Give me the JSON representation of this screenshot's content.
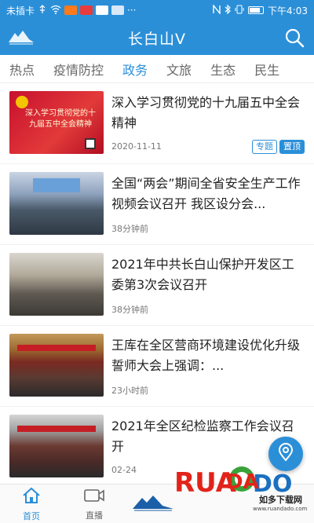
{
  "status_bar": {
    "carrier": "未插卡",
    "time": "下午4:03",
    "battery_percent": 80,
    "left_icons": [
      "usb-icon",
      "wifi-icon",
      "app-icon-1",
      "app-icon-2",
      "app-icon-3",
      "app-icon-4",
      "more-dots-icon"
    ],
    "right_icons": [
      "nfc-icon",
      "bluetooth-icon",
      "vibrate-icon",
      "battery-icon"
    ]
  },
  "header": {
    "title": "长白山V",
    "search_icon": "search-icon",
    "background": "#2b8fd8"
  },
  "tabs": [
    {
      "label": "热点",
      "active": false
    },
    {
      "label": "疫情防控",
      "active": false
    },
    {
      "label": "政务",
      "active": true
    },
    {
      "label": "文旅",
      "active": false
    },
    {
      "label": "生态",
      "active": false
    },
    {
      "label": "民生",
      "active": false
    }
  ],
  "news": [
    {
      "title": "深入学习贯彻党的十九届五中全会精神",
      "time": "2020-11-11",
      "badges": [
        "专题",
        "置顶"
      ],
      "thumb_text": "深入学习贯彻党的十九届五中全会精神"
    },
    {
      "title": "全国“两会”期间全省安全生产工作视频会议召开 我区设分会...",
      "time": "38分钟前"
    },
    {
      "title": "2021年中共长白山保护开发区工委第3次会议召开",
      "time": "38分钟前"
    },
    {
      "title": "王库在全区营商环境建设优化升级誓师大会上强调：...",
      "time": "23小时前"
    },
    {
      "title": "2021年全区纪检监察工作会议召开",
      "time": "02-24"
    }
  ],
  "bottom_nav": {
    "home": {
      "label": "首页",
      "icon": "home-icon",
      "active": true
    },
    "live": {
      "label": "直播",
      "icon": "video-camera-icon",
      "active": false
    }
  },
  "watermark": {
    "brand": "RUANDADO",
    "subtitle": "如多下载网",
    "url": "www.ruandado.com"
  },
  "colors": {
    "accent": "#2b8fd8",
    "tab_inactive": "#666666",
    "badge_topic": "#2b8fd8",
    "watermark_red": "#e2231a",
    "watermark_green": "#3aa23a",
    "watermark_blue": "#1a6fc0"
  }
}
